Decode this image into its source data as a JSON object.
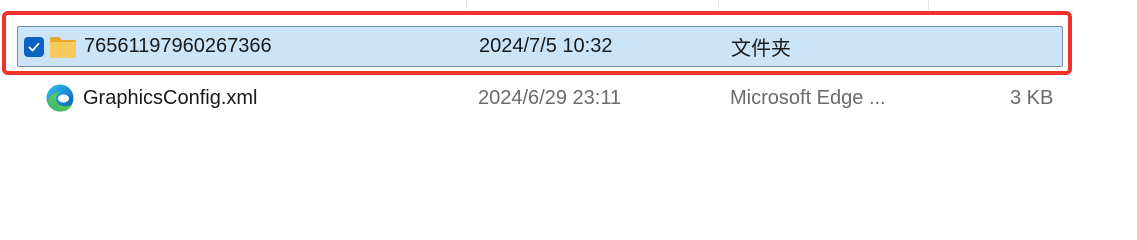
{
  "rows": [
    {
      "name": "76561197960267366",
      "date": "2024/7/5 10:32",
      "type": "文件夹",
      "size": "",
      "icon": "folder-icon",
      "selected": true,
      "checked": true
    },
    {
      "name": "GraphicsConfig.xml",
      "date": "2024/6/29 23:11",
      "type": "Microsoft Edge ...",
      "size": "3 KB",
      "icon": "edge-icon",
      "selected": false,
      "checked": false
    }
  ],
  "colors": {
    "selection_bg": "#cce4f7",
    "selection_border": "#6b8fa8",
    "highlight_border": "#f0322d",
    "checkbox": "#0a62c2",
    "folder": "#f6c445"
  }
}
